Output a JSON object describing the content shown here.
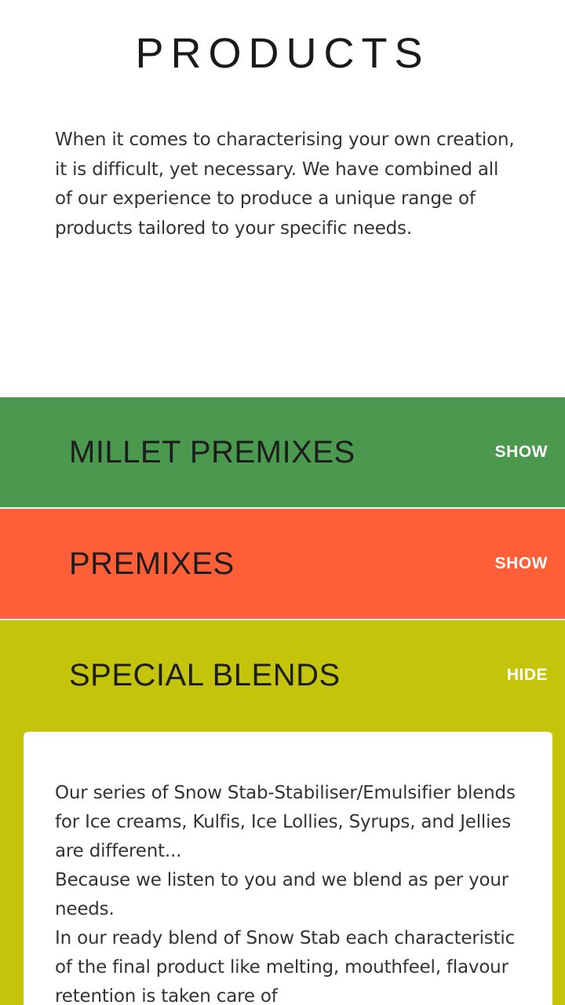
{
  "page": {
    "title": "PRODUCTS",
    "intro": "When it comes to characterising your own creation, it is difficult, yet necessary. We have combined all of our experience to produce a unique range of products tailored to your specific needs."
  },
  "sections": [
    {
      "title": "MILLET PREMIXES",
      "toggle": "SHOW",
      "color": "#4a994f"
    },
    {
      "title": "PREMIXES",
      "toggle": "SHOW",
      "color": "#fe5f37"
    },
    {
      "title": "SPECIAL BLENDS",
      "toggle": "HIDE",
      "color": "#c4c50a"
    }
  ],
  "special_blends": {
    "paragraphs": [
      "Our series of Snow Stab-Stabiliser/Emulsifier blends for Ice creams, Kulfis, Ice Lollies, Syrups, and Jellies are different...",
      "Because we listen to you and we blend as per your needs.",
      "In our ready blend of Snow Stab each characteristic of the final product like melting, mouthfeel, flavour retention is taken care of"
    ]
  }
}
